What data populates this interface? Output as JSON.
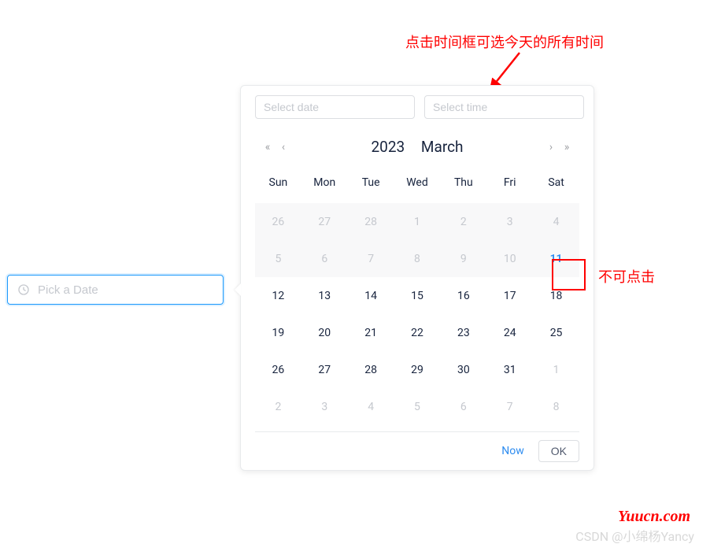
{
  "annotations": {
    "top": "点击时间框可选今天的所有时间",
    "right": "不可点击"
  },
  "input": {
    "placeholder": "Pick a Date"
  },
  "popup": {
    "date_placeholder": "Select date",
    "time_placeholder": "Select time",
    "year": "2023",
    "month": "March",
    "weekdays": [
      "Sun",
      "Mon",
      "Tue",
      "Wed",
      "Thu",
      "Fri",
      "Sat"
    ],
    "days": [
      {
        "d": "26",
        "cls": "other-month disabled"
      },
      {
        "d": "27",
        "cls": "other-month disabled"
      },
      {
        "d": "28",
        "cls": "other-month disabled"
      },
      {
        "d": "1",
        "cls": "disabled"
      },
      {
        "d": "2",
        "cls": "disabled"
      },
      {
        "d": "3",
        "cls": "disabled"
      },
      {
        "d": "4",
        "cls": "disabled"
      },
      {
        "d": "5",
        "cls": "disabled"
      },
      {
        "d": "6",
        "cls": "disabled"
      },
      {
        "d": "7",
        "cls": "disabled"
      },
      {
        "d": "8",
        "cls": "disabled"
      },
      {
        "d": "9",
        "cls": "disabled"
      },
      {
        "d": "10",
        "cls": "disabled"
      },
      {
        "d": "11",
        "cls": "disabled today"
      },
      {
        "d": "12",
        "cls": ""
      },
      {
        "d": "13",
        "cls": ""
      },
      {
        "d": "14",
        "cls": ""
      },
      {
        "d": "15",
        "cls": ""
      },
      {
        "d": "16",
        "cls": ""
      },
      {
        "d": "17",
        "cls": ""
      },
      {
        "d": "18",
        "cls": ""
      },
      {
        "d": "19",
        "cls": ""
      },
      {
        "d": "20",
        "cls": ""
      },
      {
        "d": "21",
        "cls": ""
      },
      {
        "d": "22",
        "cls": ""
      },
      {
        "d": "23",
        "cls": ""
      },
      {
        "d": "24",
        "cls": ""
      },
      {
        "d": "25",
        "cls": ""
      },
      {
        "d": "26",
        "cls": ""
      },
      {
        "d": "27",
        "cls": ""
      },
      {
        "d": "28",
        "cls": ""
      },
      {
        "d": "29",
        "cls": ""
      },
      {
        "d": "30",
        "cls": ""
      },
      {
        "d": "31",
        "cls": ""
      },
      {
        "d": "1",
        "cls": "other-month"
      },
      {
        "d": "2",
        "cls": "other-month"
      },
      {
        "d": "3",
        "cls": "other-month"
      },
      {
        "d": "4",
        "cls": "other-month"
      },
      {
        "d": "5",
        "cls": "other-month"
      },
      {
        "d": "6",
        "cls": "other-month"
      },
      {
        "d": "7",
        "cls": "other-month"
      },
      {
        "d": "8",
        "cls": "other-month"
      }
    ],
    "now_label": "Now",
    "ok_label": "OK"
  },
  "watermarks": {
    "yuucn": "Yuucn.com",
    "csdn": "CSDN @小绵杨Yancy"
  }
}
